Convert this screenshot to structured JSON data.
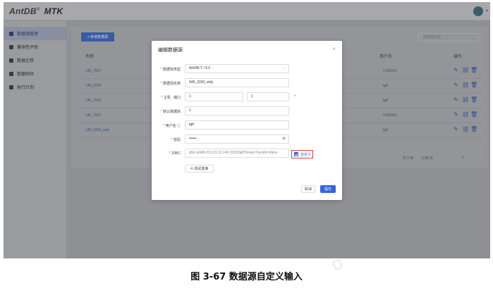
{
  "app": {
    "brand": "AntDB",
    "product": "MTK"
  },
  "sidebar": {
    "items": [
      {
        "label": "数据源管理",
        "active": true
      },
      {
        "label": "兼容性评估",
        "active": false
      },
      {
        "label": "数据迁移",
        "active": false
      },
      {
        "label": "数据校验",
        "active": false
      },
      {
        "label": "执行计划",
        "active": false
      }
    ]
  },
  "toolbar": {
    "add_label": "+ 新增数据源",
    "search_placeholder": "数据源名称"
  },
  "table": {
    "headers": {
      "name": "名称",
      "user": "用户名",
      "ops": "操作"
    },
    "rows": [
      {
        "name": "146_7527",
        "user": "CR8SAC"
      },
      {
        "name": "146_2334",
        "user": "tgtf"
      },
      {
        "name": "146_7553",
        "user": "tgtf"
      },
      {
        "name": "146_7527",
        "user": "CR8SAC"
      },
      {
        "name": "149_3333_stdy",
        "user": "tgtf"
      }
    ],
    "pager": {
      "total": "共 5 条",
      "page_size": "10条/页",
      "page": "1"
    }
  },
  "modal": {
    "title": "编辑数据源",
    "fields": {
      "db_type_label": "数据库类型",
      "db_type_value": "AntDB-T / 6.0",
      "name_label": "数据源名称",
      "name_value": "549_3333_stdy",
      "host_label": "主机 : 端口",
      "host_value": "1",
      "port_value": "1",
      "db_label": "默认数据库",
      "db_value": "1",
      "user_label": "用户名 ⓘ",
      "user_value": "tgtf",
      "pwd_label": "密码",
      "pwd_value": "••••••",
      "jdbc_label": "JDBC",
      "jdbc_value": "jdbc:antdb://10.21.10.149:3333/tgtf?binaryTransfer=false"
    },
    "custom_label": "自定义",
    "custom_checked": true,
    "test_label": "⟲ 测试连接",
    "cancel_label": "取消",
    "submit_label": "提交"
  },
  "caption": "图 3-67  数据源自定义输入",
  "colors": {
    "accent": "#3466d6",
    "highlight": "#e03a3a",
    "overlay": "#8f9093"
  }
}
